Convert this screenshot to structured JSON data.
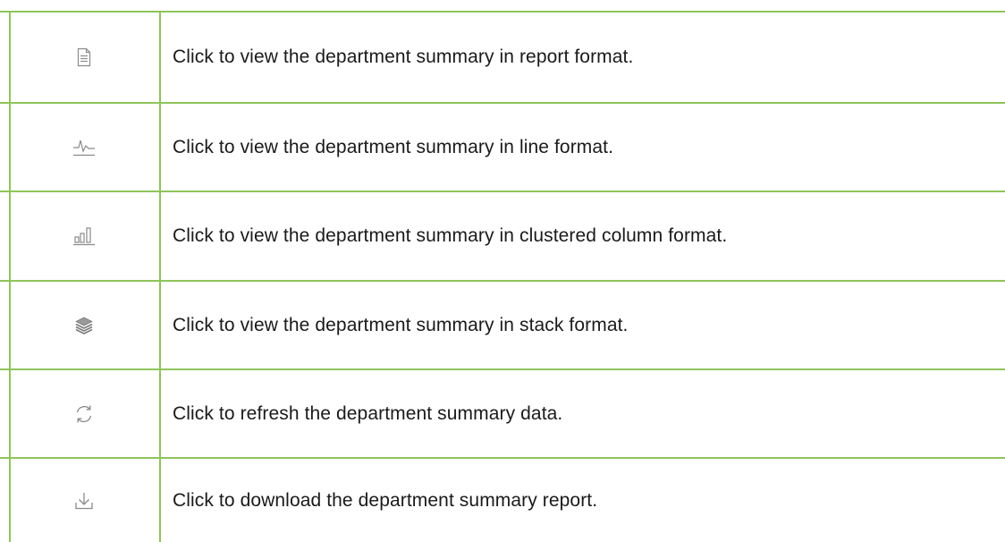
{
  "rows": [
    {
      "icon": "report-icon",
      "text": "Click to view the department summary in report format."
    },
    {
      "icon": "line-chart-icon",
      "text": "Click to view the department summary in line format."
    },
    {
      "icon": "clustered-column-icon",
      "text": "Click to view the department summary in clustered column format."
    },
    {
      "icon": "stack-icon",
      "text": "Click to view the department summary in stack format."
    },
    {
      "icon": "refresh-icon",
      "text": "Click to refresh the department summary data."
    },
    {
      "icon": "download-icon",
      "text": "Click to download the department summary report."
    }
  ],
  "colors": {
    "border": "#8fc45a",
    "icon": "#8a8a8a",
    "text": "#1a1a1a"
  }
}
